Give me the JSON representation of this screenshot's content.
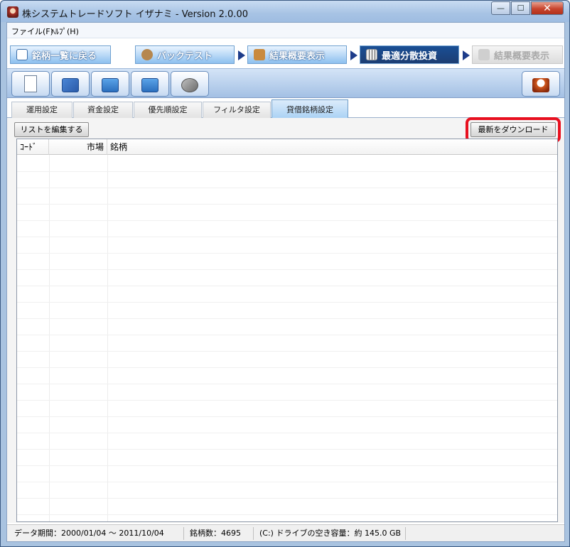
{
  "window": {
    "title": "株システムトレードソフト イザナミ - Version 2.0.00",
    "controls": {
      "minimize": "—",
      "maximize": "☐",
      "close": "✕"
    }
  },
  "menu": {
    "items": [
      "ファイル(F)",
      "ﾍﾙﾌﾟ(H)"
    ]
  },
  "nav": {
    "tabs": [
      {
        "label": "銘柄一覧に戻る",
        "icon": "eye-icon",
        "state": "normal"
      },
      {
        "label": "バックテスト",
        "icon": "backtest-icon",
        "state": "normal"
      },
      {
        "label": "結果概要表示",
        "icon": "result-icon",
        "state": "normal"
      },
      {
        "label": "最適分散投資",
        "icon": "calculator-icon",
        "state": "active"
      },
      {
        "label": "結果概要表示",
        "icon": "chart-icon",
        "state": "disabled"
      }
    ]
  },
  "toolbar": {
    "buttons": [
      "new-file-icon",
      "calendar-icon",
      "export-icon",
      "import-icon",
      "tools-icon"
    ],
    "right_button": "character-icon"
  },
  "subtabs": {
    "items": [
      "運用設定",
      "資金設定",
      "優先順設定",
      "フィルタ設定",
      "貸借銘柄設定"
    ],
    "active_index": 4
  },
  "panel": {
    "edit_list_label": "リストを編集する",
    "download_label": "最新をダウンロード"
  },
  "grid": {
    "columns": [
      "ｺｰﾄﾞ",
      "市場",
      "銘柄"
    ]
  },
  "status": {
    "data_period": "データ期間：2000/01/04 〜 2011/10/04",
    "stock_count": "銘柄数：4695",
    "disk_space": "(C:) ドライブの空き容量：約 145.0 GB"
  },
  "colors": {
    "highlight": "#e8101f",
    "nav_active": "#1c3d73",
    "toolbar": "#a3c0e4"
  }
}
